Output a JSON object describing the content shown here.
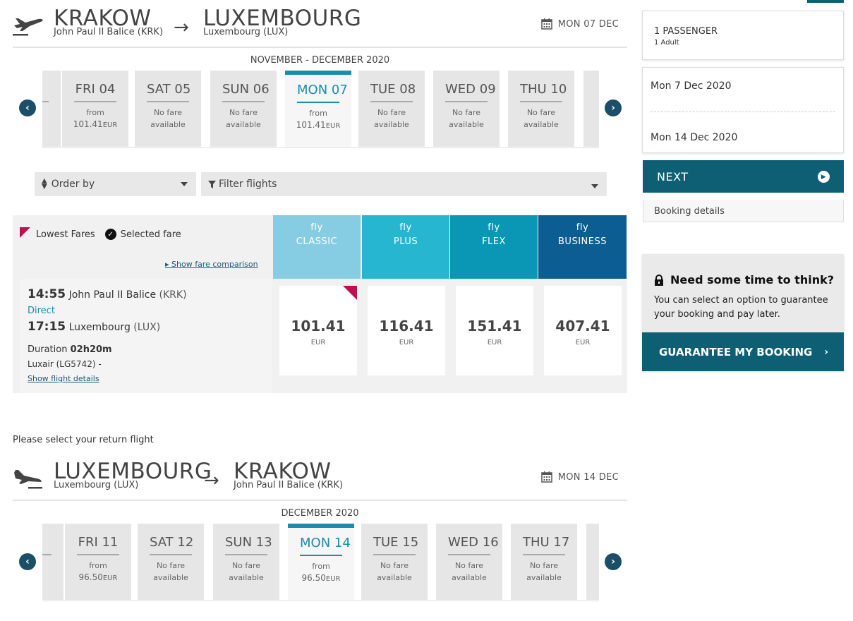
{
  "outbound": {
    "from_city": "KRAKOW",
    "from_airport": "John Paul II Balice (KRK)",
    "to_city": "LUXEMBOURG",
    "to_airport": "Luxembourg (LUX)",
    "date": "MON 07 DEC",
    "month_label": "NOVEMBER - DECEMBER 2020",
    "days": [
      {
        "day": "FRI 04",
        "line1": "from",
        "price": "101.41",
        "currency": "EUR",
        "selected": false
      },
      {
        "day": "SAT 05",
        "line1": "No fare",
        "line2": "available",
        "selected": false
      },
      {
        "day": "SUN 06",
        "line1": "No fare",
        "line2": "available",
        "selected": false
      },
      {
        "day": "MON 07",
        "line1": "from",
        "price": "101.41",
        "currency": "EUR",
        "selected": true
      },
      {
        "day": "TUE 08",
        "line1": "No fare",
        "line2": "available",
        "selected": false
      },
      {
        "day": "WED 09",
        "line1": "No fare",
        "line2": "available",
        "selected": false
      },
      {
        "day": "THU 10",
        "line1": "No fare",
        "line2": "available",
        "selected": false
      }
    ]
  },
  "filters": {
    "order_by": "Order by",
    "filter_flights": "Filter flights"
  },
  "fares": {
    "legend_lowest": "Lowest Fares",
    "legend_selected": "Selected fare",
    "show_comparison": "Show fare comparison",
    "columns": [
      {
        "top": "fly",
        "name": "CLASSIC",
        "color": "#86cde3"
      },
      {
        "top": "fly",
        "name": "PLUS",
        "color": "#27b6cf"
      },
      {
        "top": "fly",
        "name": "FLEX",
        "color": "#0997b5"
      },
      {
        "top": "fly",
        "name": "BUSINESS",
        "color": "#0c5e92"
      }
    ],
    "flight": {
      "dep_time": "14:55",
      "dep_airport": "John Paul II Balice",
      "dep_code": "(KRK)",
      "type": "Direct",
      "arr_time": "17:15",
      "arr_airport": "Luxembourg",
      "arr_code": "(LUX)",
      "duration_label": "Duration",
      "duration": "02h20m",
      "operator": "Luxair (LG5742) -",
      "details_link": "Show flight details"
    },
    "prices": [
      {
        "price": "101.41",
        "currency": "EUR"
      },
      {
        "price": "116.41",
        "currency": "EUR"
      },
      {
        "price": "151.41",
        "currency": "EUR"
      },
      {
        "price": "407.41",
        "currency": "EUR"
      }
    ],
    "lowest_color": "#c0104e"
  },
  "return_prompt": "Please select your return flight",
  "inbound": {
    "from_city": "LUXEMBOURG",
    "from_airport": "Luxembourg (LUX)",
    "to_city": "KRAKOW",
    "to_airport": "John Paul II Balice (KRK)",
    "date": "MON 14 DEC",
    "month_label": "DECEMBER 2020",
    "days": [
      {
        "day": "FRI 11",
        "line1": "from",
        "price": "96.50",
        "currency": "EUR",
        "selected": false
      },
      {
        "day": "SAT 12",
        "line1": "No fare",
        "line2": "available",
        "selected": false
      },
      {
        "day": "SUN 13",
        "line1": "No fare",
        "line2": "available",
        "selected": false
      },
      {
        "day": "MON 14",
        "line1": "from",
        "price": "96.50",
        "currency": "EUR",
        "selected": true
      },
      {
        "day": "TUE 15",
        "line1": "No fare",
        "line2": "available",
        "selected": false
      },
      {
        "day": "WED 16",
        "line1": "No fare",
        "line2": "available",
        "selected": false
      },
      {
        "day": "THU 17",
        "line1": "No fare",
        "line2": "available",
        "selected": false
      }
    ]
  },
  "sidebar": {
    "passengers": "1 PASSENGER",
    "passengers_detail": "1 Adult",
    "depart_date": "Mon 7 Dec 2020",
    "return_date": "Mon 14 Dec 2020",
    "next_label": "NEXT",
    "booking_details": "Booking details",
    "think_title": "Need some time to think?",
    "think_text": "You can select an option to guarantee your booking and pay later.",
    "guarantee_label": "GUARANTEE MY BOOKING"
  },
  "colors": {
    "accent": "#1b8cae",
    "button": "#0e5f74"
  }
}
